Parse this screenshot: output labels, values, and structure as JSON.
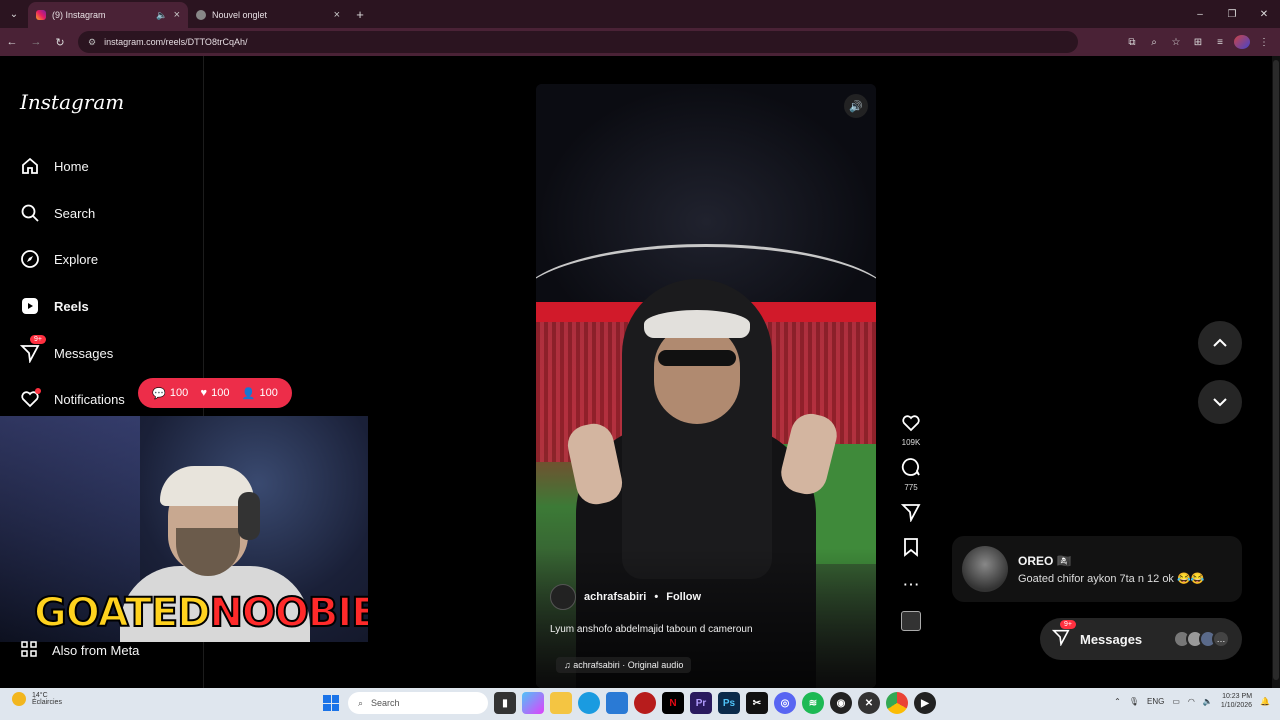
{
  "browser": {
    "tabs": [
      {
        "title": "(9) Instagram",
        "active": true
      },
      {
        "title": "Nouvel onglet",
        "active": false
      }
    ],
    "url": "instagram.com/reels/DTTO8trCqAh/",
    "window_controls": {
      "minimize": "–",
      "restore": "❐",
      "close": "✕"
    }
  },
  "sidebar": {
    "logo": "Instagram",
    "items": [
      {
        "label": "Home",
        "icon": "home-icon"
      },
      {
        "label": "Search",
        "icon": "search-icon"
      },
      {
        "label": "Explore",
        "icon": "compass-icon"
      },
      {
        "label": "Reels",
        "icon": "reels-icon"
      },
      {
        "label": "Messages",
        "icon": "messenger-icon",
        "badge": "9+"
      },
      {
        "label": "Notifications",
        "icon": "heart-icon"
      }
    ],
    "also_from_meta": "Also from Meta"
  },
  "stats_pill": {
    "comments": "100",
    "likes": "100",
    "followers": "100"
  },
  "webcam": {
    "brand_left": "GOATED",
    "brand_right": "NOOBIE"
  },
  "reel": {
    "author": "achrafsabiri",
    "separator": "•",
    "follow_label": "Follow",
    "caption": "Lyum anshofo abdelmajid taboun d cameroun",
    "audio": "achrafsabiri · Original audio",
    "likes": "109K",
    "comments": "775"
  },
  "note": {
    "name": "OREO 🏴‍☠️",
    "message": "Goated chifor aykon 7ta n 12 ok 😂😂"
  },
  "messages_pill": {
    "label": "Messages",
    "badge": "9+"
  },
  "taskbar": {
    "weather_temp": "14°C",
    "weather_desc": "Éclaircies",
    "search_placeholder": "Search",
    "lang": "ENG",
    "time": "10:23 PM",
    "date": "1/10/2026"
  },
  "colors": {
    "accent_red": "#ff3040",
    "stats_pill": "#ed2d49",
    "chrome_tab": "#4a2236"
  }
}
